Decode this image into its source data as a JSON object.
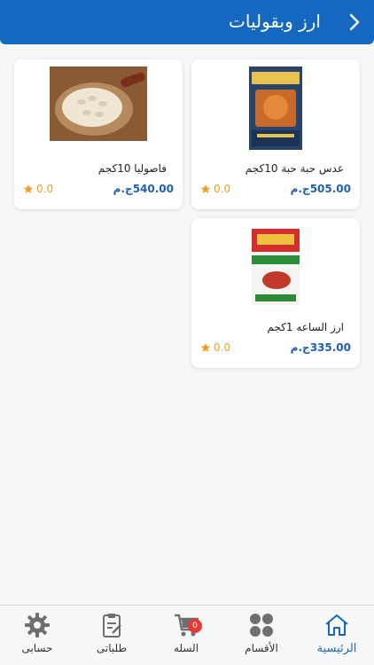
{
  "header": {
    "title": "ارز وبقوليات"
  },
  "products": [
    {
      "name": "عدس حبة حبة 10كجم",
      "price": "505.00ج.م",
      "rating": "0.0"
    },
    {
      "name": "فاصوليا 10كجم",
      "price": "540.00ج.م",
      "rating": "0.0"
    },
    {
      "name": "ارز الساعه 1كجم",
      "price": "335.00ج.م",
      "rating": "0.0"
    }
  ],
  "tabs": [
    {
      "label": "الرئيسية"
    },
    {
      "label": "الأقسام"
    },
    {
      "label": "السله",
      "badge": "0"
    },
    {
      "label": "طلباتى"
    },
    {
      "label": "حسابى"
    }
  ],
  "colors": {
    "primary": "#1568c0",
    "price": "#1f5fb3",
    "star": "#f0a020",
    "badge": "#e53935"
  }
}
